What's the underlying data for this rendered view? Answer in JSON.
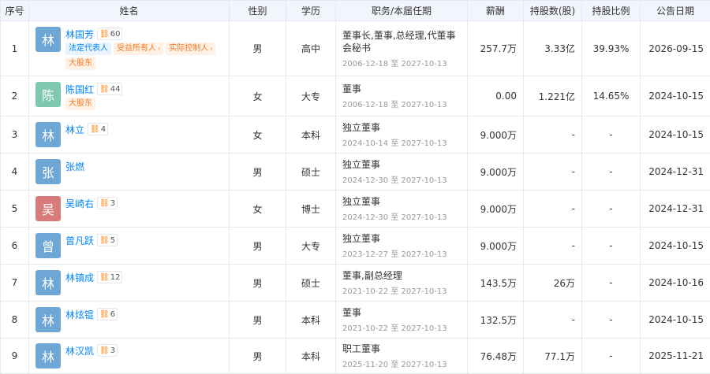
{
  "headers": {
    "idx": "序号",
    "name": "姓名",
    "gender": "性别",
    "edu": "学历",
    "position": "职务/本届任期",
    "salary": "薪酬",
    "shares": "持股数(股)",
    "ratio": "持股比例",
    "date": "公告日期"
  },
  "term_sep": "至",
  "avatar_colors": {
    "blue": "#6ea6d6",
    "green": "#7ec8b0",
    "red": "#d97b7b"
  },
  "rows": [
    {
      "idx": "1",
      "avatar": "林",
      "avatar_color": "#6ea6d6",
      "name": "林国芳",
      "badge_count": "60",
      "tags": [
        {
          "text": "法定代表人",
          "color": "blue"
        },
        {
          "text": "受益所有人",
          "color": "orange",
          "arrow": "›"
        },
        {
          "text": "实际控制人",
          "color": "orange",
          "arrow": "›"
        },
        {
          "text": "大股东",
          "color": "orange"
        }
      ],
      "gender": "男",
      "edu": "高中",
      "position": "董事长,董事,总经理,代董事会秘书",
      "term_start": "2006-12-18",
      "term_end": "2027-10-13",
      "salary": "257.7万",
      "shares": "3.33亿",
      "ratio": "39.93%",
      "date": "2026-09-15"
    },
    {
      "idx": "2",
      "avatar": "陈",
      "avatar_color": "#7ec8b0",
      "name": "陈国红",
      "badge_count": "44",
      "tags": [
        {
          "text": "大股东",
          "color": "orange"
        }
      ],
      "gender": "女",
      "edu": "大专",
      "position": "董事",
      "term_start": "2006-12-18",
      "term_end": "2027-10-13",
      "salary": "0.00",
      "shares": "1.221亿",
      "ratio": "14.65%",
      "date": "2024-10-15"
    },
    {
      "idx": "3",
      "avatar": "林",
      "avatar_color": "#6ea6d6",
      "name": "林立",
      "badge_count": "4",
      "tags": [],
      "gender": "女",
      "edu": "本科",
      "position": "独立董事",
      "term_start": "2024-10-14",
      "term_end": "2027-10-13",
      "salary": "9.000万",
      "shares": "-",
      "ratio": "-",
      "date": "2024-10-15"
    },
    {
      "idx": "4",
      "avatar": "张",
      "avatar_color": "#6ea6d6",
      "name": "张燃",
      "badge_count": "",
      "tags": [],
      "gender": "男",
      "edu": "硕士",
      "position": "独立董事",
      "term_start": "2024-12-30",
      "term_end": "2027-10-13",
      "salary": "9.000万",
      "shares": "-",
      "ratio": "-",
      "date": "2024-12-31"
    },
    {
      "idx": "5",
      "avatar": "吴",
      "avatar_color": "#d97b7b",
      "name": "吴崎右",
      "badge_count": "3",
      "tags": [],
      "gender": "女",
      "edu": "博士",
      "position": "独立董事",
      "term_start": "2024-12-30",
      "term_end": "2027-10-13",
      "salary": "9.000万",
      "shares": "-",
      "ratio": "-",
      "date": "2024-12-31"
    },
    {
      "idx": "6",
      "avatar": "曾",
      "avatar_color": "#6ea6d6",
      "name": "曾凡跃",
      "badge_count": "5",
      "tags": [],
      "gender": "男",
      "edu": "大专",
      "position": "独立董事",
      "term_start": "2023-12-27",
      "term_end": "2027-10-13",
      "salary": "9.000万",
      "shares": "-",
      "ratio": "-",
      "date": "2024-10-15"
    },
    {
      "idx": "7",
      "avatar": "林",
      "avatar_color": "#6ea6d6",
      "name": "林镇成",
      "badge_count": "12",
      "tags": [],
      "gender": "男",
      "edu": "硕士",
      "position": "董事,副总经理",
      "term_start": "2021-10-22",
      "term_end": "2027-10-13",
      "salary": "143.5万",
      "shares": "26万",
      "ratio": "-",
      "date": "2024-10-16"
    },
    {
      "idx": "8",
      "avatar": "林",
      "avatar_color": "#6ea6d6",
      "name": "林炫锟",
      "badge_count": "6",
      "tags": [],
      "gender": "男",
      "edu": "本科",
      "position": "董事",
      "term_start": "2021-10-22",
      "term_end": "2027-10-13",
      "salary": "132.5万",
      "shares": "-",
      "ratio": "-",
      "date": "2024-10-15"
    },
    {
      "idx": "9",
      "avatar": "林",
      "avatar_color": "#6ea6d6",
      "name": "林汉凯",
      "badge_count": "3",
      "tags": [],
      "gender": "男",
      "edu": "本科",
      "position": "职工董事",
      "term_start": "2025-11-20",
      "term_end": "2027-10-13",
      "salary": "76.48万",
      "shares": "77.1万",
      "ratio": "-",
      "date": "2025-11-21"
    }
  ]
}
